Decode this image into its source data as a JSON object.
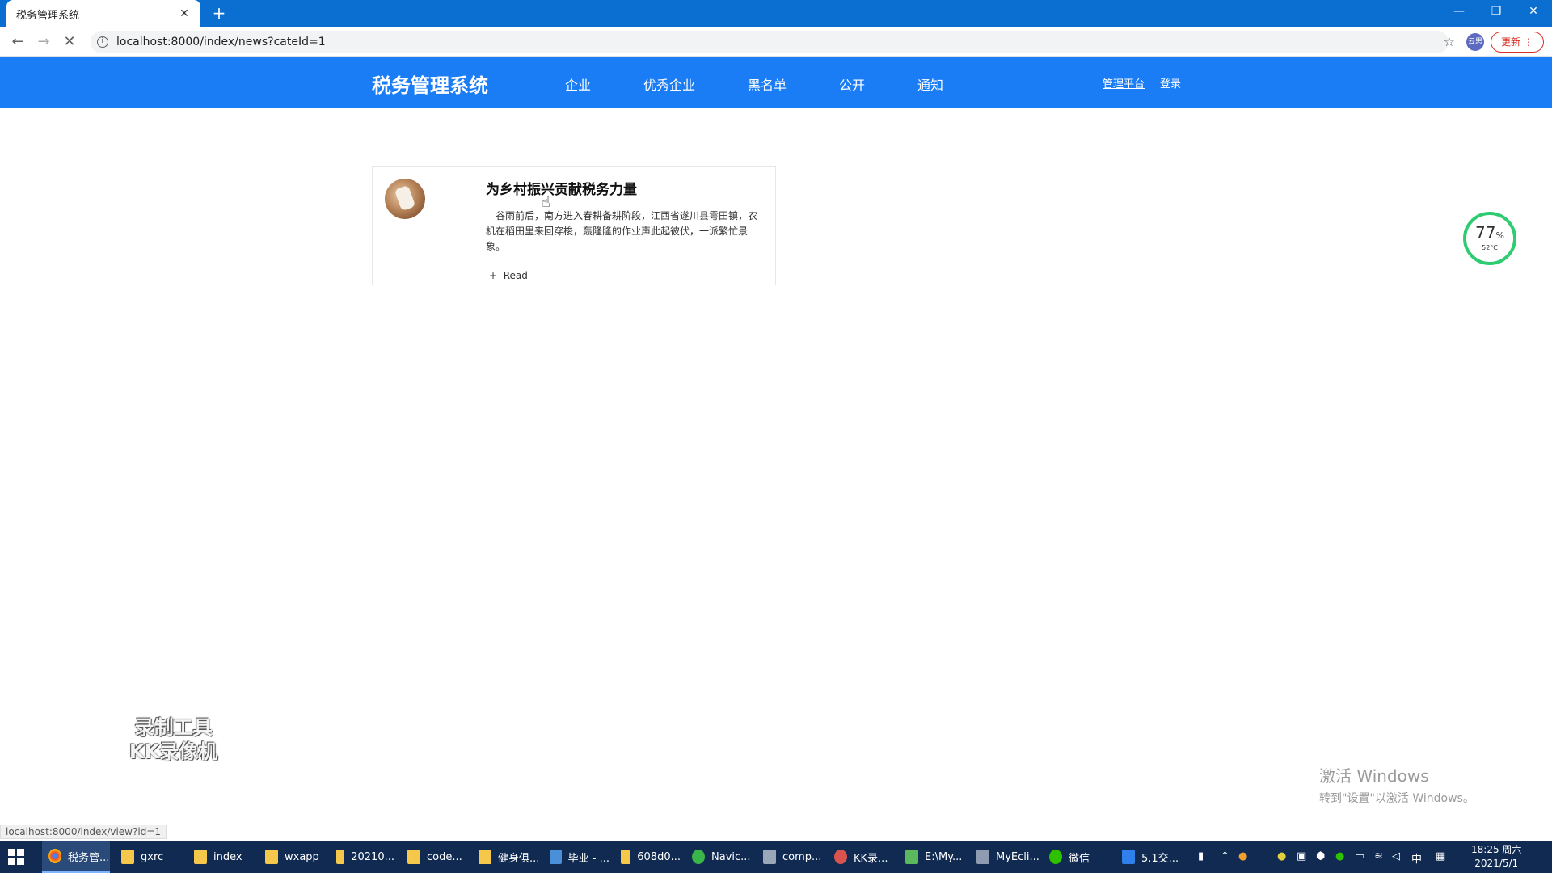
{
  "browser": {
    "tab_title": "税务管理系统",
    "url": "localhost:8000/index/news?cateId=1",
    "update_label": "更新",
    "profile_label": "云思"
  },
  "site": {
    "logo": "税务管理系统",
    "nav": [
      "企业",
      "优秀企业",
      "黑名单",
      "公开",
      "通知"
    ],
    "admin_link": "管理平台",
    "login_link": "登录"
  },
  "article": {
    "title": "为乡村振兴贡献税务力量",
    "body": "　谷雨前后，南方进入春耕备耕阶段，江西省遂川县雩田镇，农机在稻田里来回穿梭，轰隆隆的作业声此起彼伏，一派繁忙景象。",
    "read_label": "Read"
  },
  "widget": {
    "percent": "77",
    "percent_unit": "%",
    "temperature": "52°C"
  },
  "watermark": {
    "line1": "录制工具",
    "line2": "KK录像机"
  },
  "activation": {
    "line1": "激活 Windows",
    "line2": "转到\"设置\"以激活 Windows。"
  },
  "status_url": "localhost:8000/index/view?id=1",
  "taskbar": {
    "items": [
      "税务管...",
      "gxrc",
      "index",
      "wxapp",
      "20210...",
      "code...",
      "健身俱...",
      "毕业 - ...",
      "608d0...",
      "Navic...",
      "comp...",
      "KK录...",
      "E:\\My...",
      "MyEcli...",
      "微信",
      "5.1交..."
    ],
    "ime": "中",
    "time": "18:25 周六",
    "date": "2021/5/1"
  },
  "colors": {
    "tabbar": "#0a6fd1",
    "header": "#1a7df5",
    "widget_ring": "#2ecc71",
    "taskbar": "#102a52"
  }
}
